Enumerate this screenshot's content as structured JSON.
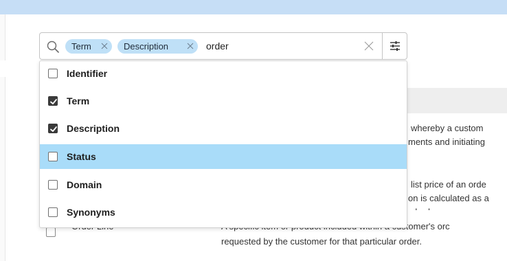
{
  "search": {
    "chips": [
      {
        "label": "Term"
      },
      {
        "label": "Description"
      }
    ],
    "query": "order"
  },
  "dropdown": {
    "options": [
      {
        "label": "Identifier",
        "checked": false
      },
      {
        "label": "Term",
        "checked": true
      },
      {
        "label": "Description",
        "checked": true
      },
      {
        "label": "Status",
        "checked": false,
        "highlighted": true
      },
      {
        "label": "Domain",
        "checked": false
      },
      {
        "label": "Synonyms",
        "checked": false
      }
    ]
  },
  "background_table": {
    "rows": [
      {
        "text_1": "whereby a custom",
        "text_2": "ments and initiating"
      },
      {
        "text_1": "list price of an orde",
        "text_2": "on is calculated as a",
        "text_3": "dard"
      },
      {
        "term": "Order Line",
        "desc_1": "A specific item or product included within a customer's orc",
        "desc_2": "requested by the customer for that particular order."
      }
    ]
  },
  "colors": {
    "topbar": "#c6def6",
    "chip": "#bfe0f7",
    "highlight": "#a9dcf9"
  }
}
